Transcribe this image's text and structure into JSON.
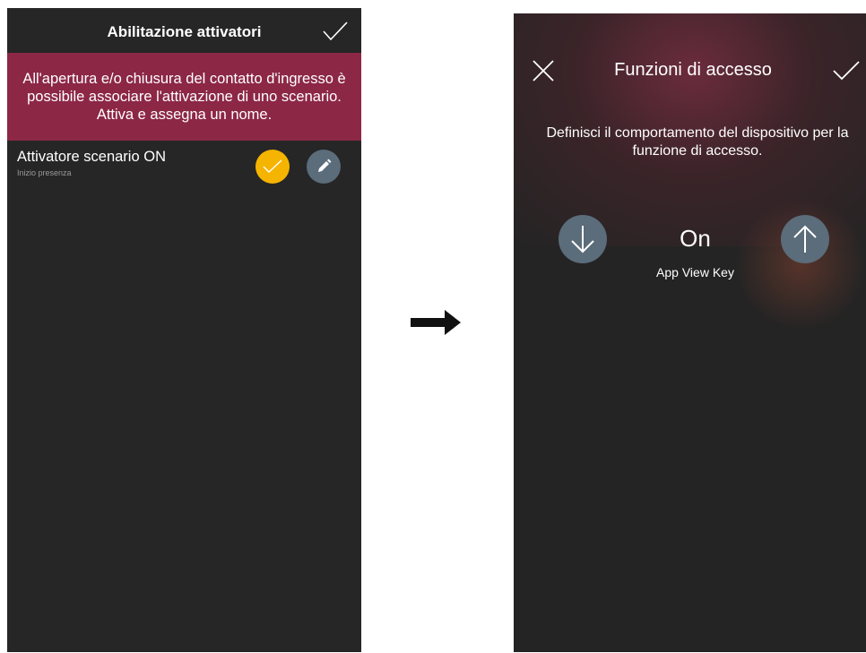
{
  "left_screen": {
    "title": "Abilitazione attivatori",
    "banner_text": "All'apertura e/o chiusura del contatto d'ingresso è possibile associare l'attivazione di uno scenario. Attiva e assegna un nome.",
    "item": {
      "title": "Attivatore scenario ON",
      "subtitle": "Inizio presenza",
      "toggle_state": "checked"
    },
    "colors": {
      "background": "#262626",
      "banner": "#8c2746",
      "toggle_active": "#f5b400",
      "edit_button": "#5b6c7a"
    }
  },
  "arrow": {
    "icon": "right-arrow-icon"
  },
  "right_screen": {
    "title": "Funzioni di accesso",
    "description": "Definisci il comportamento del dispositivo per la funzione di accesso.",
    "state_value": "On",
    "state_label": "App View Key",
    "colors": {
      "background": "#242424",
      "button": "#5b6c7a"
    }
  }
}
